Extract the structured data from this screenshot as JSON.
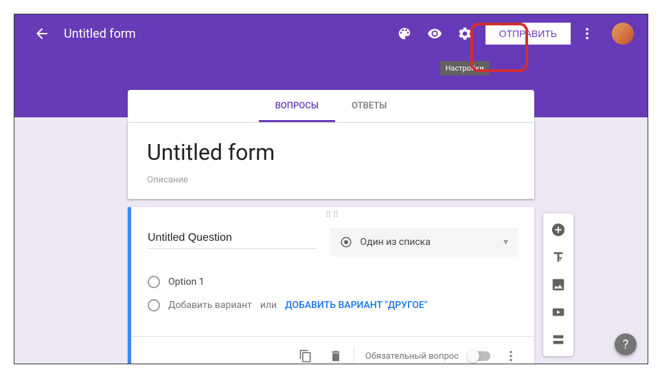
{
  "header": {
    "title": "Untitled form",
    "send_label": "ОТПРАВИТЬ",
    "tooltip": "Настройки"
  },
  "tabs": {
    "questions": "ВОПРОСЫ",
    "responses": "ОТВЕТЫ"
  },
  "form": {
    "title": "Untitled form",
    "description": "Описание"
  },
  "question": {
    "title": "Untitled Question",
    "type_label": "Один из списка",
    "option1": "Option 1",
    "add_option": "Добавить вариант",
    "or": "или",
    "add_other": "ДОБАВИТЬ ВАРИАНТ \"ДРУГОЕ\"",
    "required_label": "Обязательный вопрос"
  }
}
